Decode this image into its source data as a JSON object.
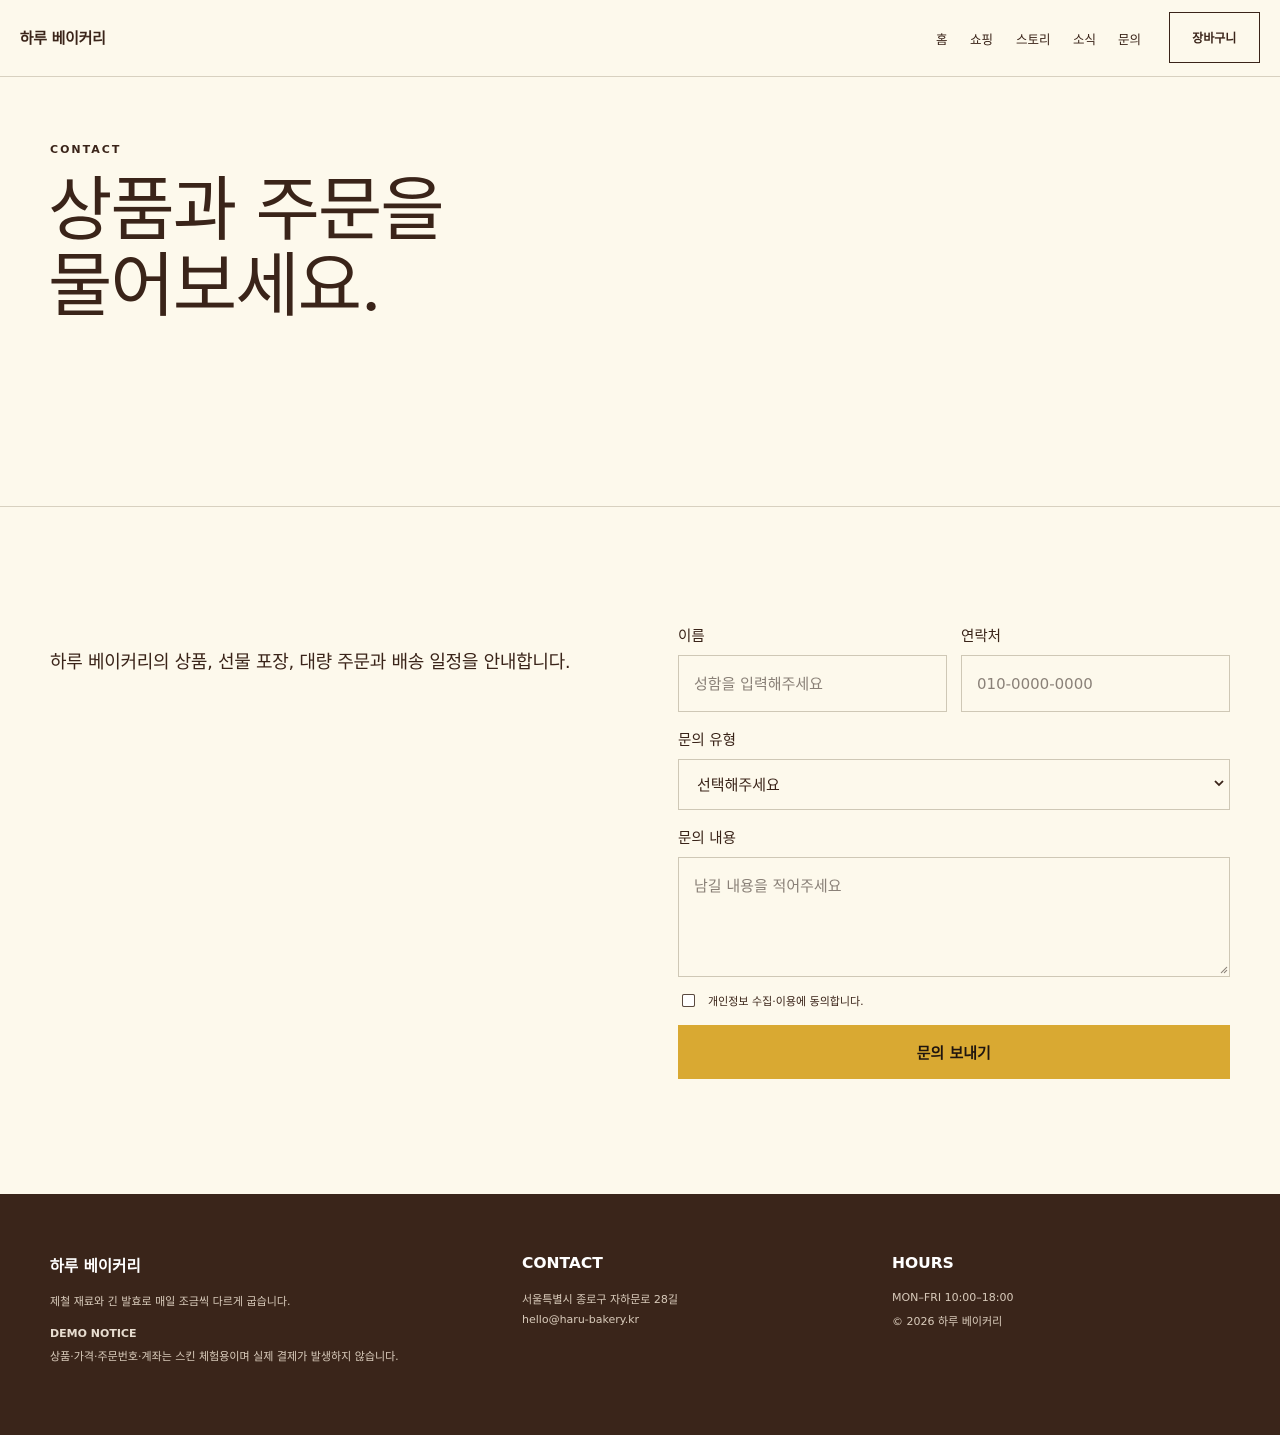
{
  "header": {
    "brand": "하루 베이커리",
    "nav": [
      "홈",
      "쇼핑",
      "스토리",
      "소식",
      "문의"
    ],
    "cart_label": "장바구니"
  },
  "hero": {
    "eyebrow": "CONTACT",
    "title_line1": "상품과 주문을",
    "title_line2": "물어보세요."
  },
  "contact": {
    "intro": "하루 베이커리의 상품, 선물 포장, 대량 주문과 배송 일정을 안내합니다.",
    "form": {
      "name_label": "이름",
      "name_placeholder": "성함을 입력해주세요",
      "phone_label": "연락처",
      "phone_placeholder": "010-0000-0000",
      "type_label": "문의 유형",
      "type_selected": "선택해주세요",
      "message_label": "문의 내용",
      "message_placeholder": "남길 내용을 적어주세요",
      "consent_label": "개인정보 수집·이용에 동의합니다.",
      "submit_label": "문의 보내기"
    }
  },
  "footer": {
    "brand": "하루 베이커리",
    "tagline": "제철 재료와 긴 발효로 매일 조금씩 다르게 굽습니다.",
    "notice_title": "DEMO NOTICE",
    "notice_text": "상품·가격·주문번호·계좌는 스킨 체험용이며 실제 결제가 발생하지 않습니다.",
    "contact_title": "CONTACT",
    "address": "서울특별시 종로구 자하문로 28길",
    "email": "hello@haru-bakery.kr",
    "hours_title": "HOURS",
    "hours": "MON–FRI 10:00–18:00",
    "copyright": "© 2026 하루 베이커리"
  },
  "colors": {
    "background": "#fdf9ec",
    "text": "#3a2419",
    "accent": "#d9a932",
    "footer_bg": "#3a251a"
  }
}
